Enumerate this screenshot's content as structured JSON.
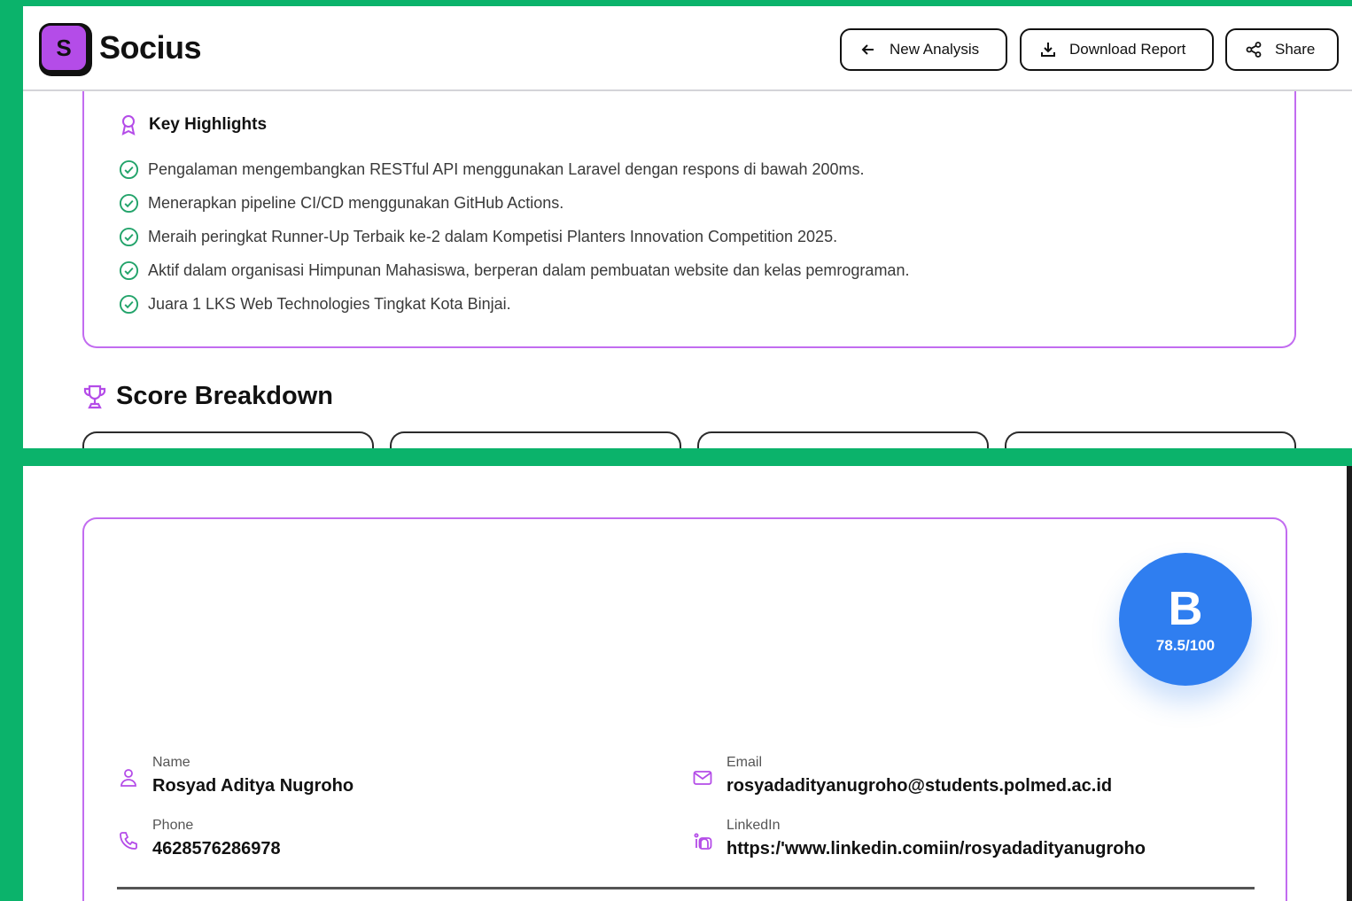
{
  "app": {
    "logo_letter": "S",
    "name": "Socius",
    "accent": "#b44ce8",
    "frame_color": "#0bb36b"
  },
  "header": {
    "new_analysis": "New Analysis",
    "download_report": "Download Report",
    "share": "Share"
  },
  "highlights": {
    "title": "Key Highlights",
    "items": [
      "Pengalaman mengembangkan RESTful API menggunakan Laravel dengan respons di bawah 200ms.",
      "Menerapkan pipeline CI/CD menggunakan GitHub Actions.",
      "Meraih peringkat Runner-Up Terbaik ke-2 dalam Kompetisi Planters Innovation Competition 2025.",
      "Aktif dalam organisasi Himpunan Mahasiswa, berperan dalam pembuatan website dan kelas pemrograman.",
      "Juara 1 LKS Web Technologies Tingkat Kota Binjai."
    ]
  },
  "score_breakdown": {
    "title": "Score Breakdown"
  },
  "profile": {
    "grade": "B",
    "score": "78.5/100",
    "grade_color": "#2f7ef0",
    "name_label": "Name",
    "name": "Rosyad Aditya Nugroho",
    "phone_label": "Phone",
    "phone": "4628576286978",
    "email_label": "Email",
    "email": "rosyadadityanugroho@students.polmed.ac.id",
    "linkedin_label": "LinkedIn",
    "linkedin": "https:/'www.linkedin.comiin/rosyadadityanugroho"
  }
}
